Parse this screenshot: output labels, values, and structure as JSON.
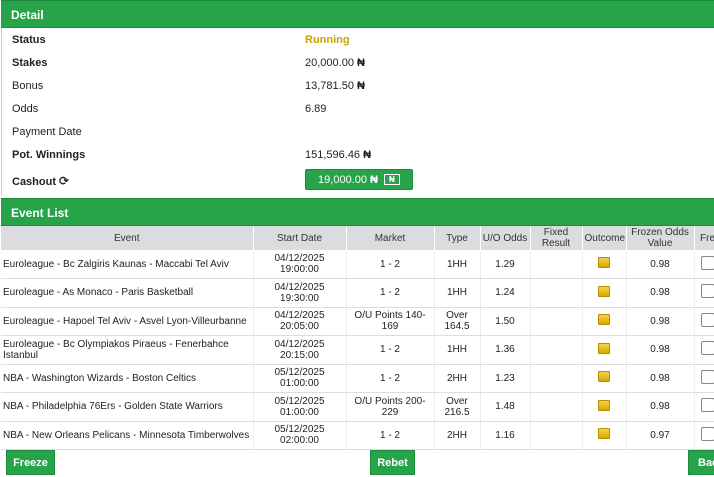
{
  "detail": {
    "header": "Detail",
    "status": {
      "label": "Status",
      "value": "Running"
    },
    "stakes": {
      "label": "Stakes",
      "value": "20,000.00",
      "currency": "₦"
    },
    "bonus": {
      "label": "Bonus",
      "value": "13,781.50",
      "currency": "₦"
    },
    "odds": {
      "label": "Odds",
      "value": "6.89"
    },
    "payment_date": {
      "label": "Payment Date",
      "value": ""
    },
    "pot_winnings": {
      "label": "Pot. Winnings",
      "value": "151,596.46",
      "currency": "₦"
    },
    "cashout": {
      "label": "Cashout",
      "value": "19,000.00",
      "currency": "₦",
      "box_text": "₦"
    }
  },
  "events": {
    "header": "Event List",
    "columns": [
      "Event",
      "Start Date",
      "Market",
      "Type",
      "U/O Odds",
      "Fixed Result",
      "Outcome",
      "Frozen Odds Value",
      "Fre"
    ],
    "rows": [
      {
        "event": "Euroleague - Bc Zalgiris Kaunas - Maccabi Tel Aviv",
        "date": "04/12/2025",
        "time": "19:00:00",
        "market": "1 - 2",
        "type": "1HH",
        "odds": "1.29",
        "fixed": "",
        "frozen": "0.98"
      },
      {
        "event": "Euroleague - As Monaco - Paris Basketball",
        "date": "04/12/2025",
        "time": "19:30:00",
        "market": "1 - 2",
        "type": "1HH",
        "odds": "1.24",
        "fixed": "",
        "frozen": "0.98"
      },
      {
        "event": "Euroleague - Hapoel Tel Aviv - Asvel Lyon-Villeurbanne",
        "date": "04/12/2025",
        "time": "20:05:00",
        "market": "O/U Points 140-169",
        "type": "Over 164.5",
        "odds": "1.50",
        "fixed": "",
        "frozen": "0.98"
      },
      {
        "event": "Euroleague - Bc Olympiakos Piraeus - Fenerbahce Istanbul",
        "date": "04/12/2025",
        "time": "20:15:00",
        "market": "1 - 2",
        "type": "1HH",
        "odds": "1.36",
        "fixed": "",
        "frozen": "0.98"
      },
      {
        "event": "NBA - Washington Wizards - Boston Celtics",
        "date": "05/12/2025",
        "time": "01:00:00",
        "market": "1 - 2",
        "type": "2HH",
        "odds": "1.23",
        "fixed": "",
        "frozen": "0.98"
      },
      {
        "event": "NBA - Philadelphia 76Ers - Golden State Warriors",
        "date": "05/12/2025",
        "time": "01:00:00",
        "market": "O/U Points 200-229",
        "type": "Over 216.5",
        "odds": "1.48",
        "fixed": "",
        "frozen": "0.98"
      },
      {
        "event": "NBA - New Orleans Pelicans - Minnesota Timberwolves",
        "date": "05/12/2025",
        "time": "02:00:00",
        "market": "1 - 2",
        "type": "2HH",
        "odds": "1.16",
        "fixed": "",
        "frozen": "0.97"
      }
    ]
  },
  "buttons": {
    "freeze": "Freeze",
    "rebet": "Rebet",
    "back": "Back"
  }
}
